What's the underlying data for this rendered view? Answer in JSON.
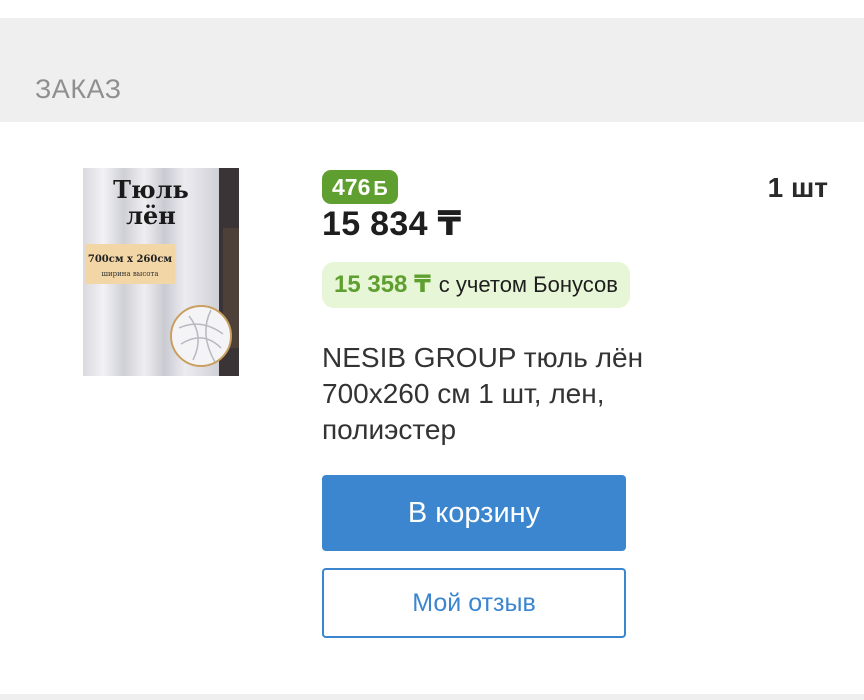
{
  "section": {
    "title": "ЗАКАЗ"
  },
  "product": {
    "image_label_line1": "Тюль",
    "image_label_line2": "лён",
    "image_size": "700см x 260см",
    "image_size_caption": "ширина   высота",
    "bonus_badge": "476",
    "bonus_symbol": "Б",
    "price": "15 834 ₸",
    "bonus_price_amount": "15 358 ₸",
    "bonus_price_text": "с учетом Бонусов",
    "title": "NESIB GROUP тюль лён 700x260 см 1 шт, лен, полиэстер",
    "quantity": "1 шт"
  },
  "actions": {
    "cart_button": "В корзину",
    "review_button": "Мой отзыв"
  },
  "colors": {
    "accent_blue": "#3b86cf",
    "bonus_green": "#5f9f2f",
    "bonus_bg": "#e6f6d6",
    "header_bg": "#efefef"
  }
}
